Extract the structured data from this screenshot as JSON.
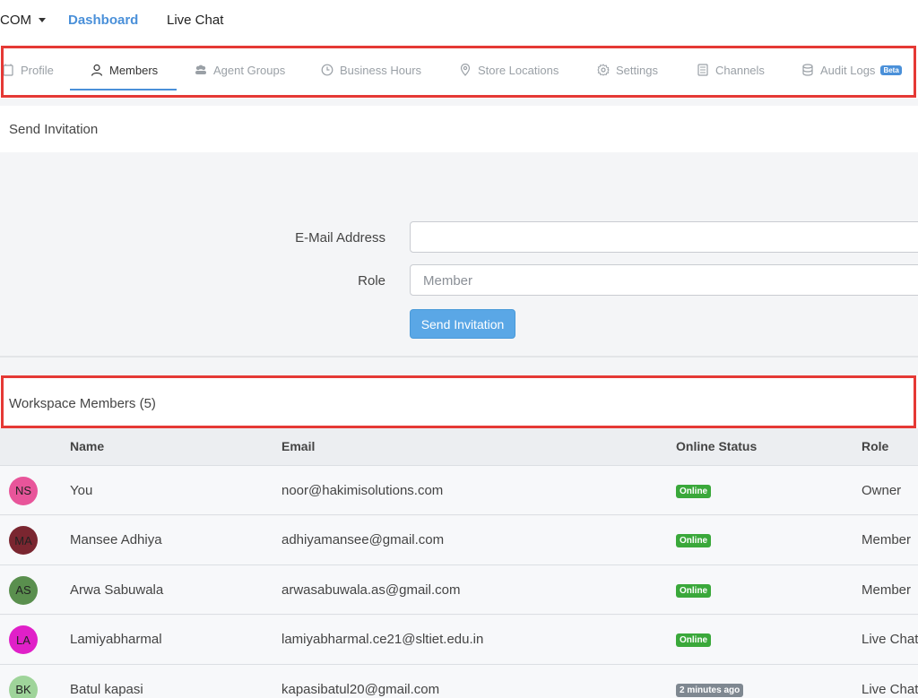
{
  "topnav": {
    "brand": "COM",
    "links": [
      "Dashboard",
      "Live Chat"
    ]
  },
  "tabs": [
    {
      "label": "Profile",
      "icon": "profile-icon"
    },
    {
      "label": "Members",
      "icon": "user-icon"
    },
    {
      "label": "Agent Groups",
      "icon": "users-icon"
    },
    {
      "label": "Business Hours",
      "icon": "clock-icon"
    },
    {
      "label": "Store Locations",
      "icon": "location-pin-icon"
    },
    {
      "label": "Settings",
      "icon": "gear-icon"
    },
    {
      "label": "Channels",
      "icon": "channels-icon"
    },
    {
      "label": "Audit Logs",
      "icon": "database-icon",
      "badge": "Beta"
    }
  ],
  "active_tab": "Members",
  "invitation": {
    "title": "Send Invitation",
    "email_label": "E-Mail Address",
    "email_value": "",
    "role_label": "Role",
    "role_value": "Member",
    "send_label": "Send Invitation"
  },
  "members": {
    "title": "Workspace Members (5)",
    "columns": [
      "Name",
      "Email",
      "Online Status",
      "Role"
    ],
    "rows": [
      {
        "initials": "NS",
        "avatar_color": "#e8559a",
        "name": "You",
        "email": "noor@hakimisolutions.com",
        "status": "Online",
        "role": "Owner"
      },
      {
        "initials": "MA",
        "avatar_color": "#7a2630",
        "name": "Mansee Adhiya",
        "email": "adhiyamansee@gmail.com",
        "status": "Online",
        "role": "Member"
      },
      {
        "initials": "AS",
        "avatar_color": "#5a8f4e",
        "name": "Arwa Sabuwala",
        "email": "arwasabuwala.as@gmail.com",
        "status": "Online",
        "role": "Member"
      },
      {
        "initials": "LA",
        "avatar_color": "#e020c8",
        "name": "Lamiyabharmal",
        "email": "lamiyabharmal.ce21@sltiet.edu.in",
        "status": "Online",
        "role": "Live Chat"
      },
      {
        "initials": "BK",
        "avatar_color": "#9fd49a",
        "name": "Batul kapasi",
        "email": "kapasibatul20@gmail.com",
        "status": "2 minutes ago",
        "role": "Live Chat"
      }
    ]
  },
  "colors": {
    "accent": "#4a90d9",
    "online": "#3aa83a",
    "away": "#7f8891",
    "highlight_frame": "#e53935"
  }
}
